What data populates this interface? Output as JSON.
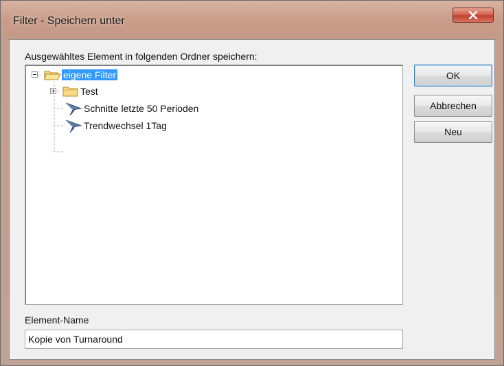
{
  "window": {
    "title": "Filter - Speichern unter",
    "close_label": "x"
  },
  "tree": {
    "label": "Ausgewähltes Element in folgenden Ordner speichern:",
    "root": {
      "label": "eigene Filter",
      "expanded": true,
      "selected": true,
      "icon": "open-folder-icon"
    },
    "children": [
      {
        "label": "Test",
        "expanded": false,
        "icon": "folder-icon"
      },
      {
        "label": "Schnitte letzte 50 Perioden",
        "icon": "funnel-filter-icon"
      },
      {
        "label": "Trendwechsel 1Tag",
        "icon": "funnel-filter-icon"
      }
    ]
  },
  "buttons": {
    "ok": "OK",
    "cancel": "Abbrechen",
    "new": "Neu"
  },
  "element_name": {
    "label": "Element-Name",
    "value": "Kopie von Turnaround"
  },
  "colors": {
    "selection": "#3399ff",
    "titlebar": "#c99d89",
    "close_button": "#c1412e",
    "folder": "#f2c94c"
  }
}
